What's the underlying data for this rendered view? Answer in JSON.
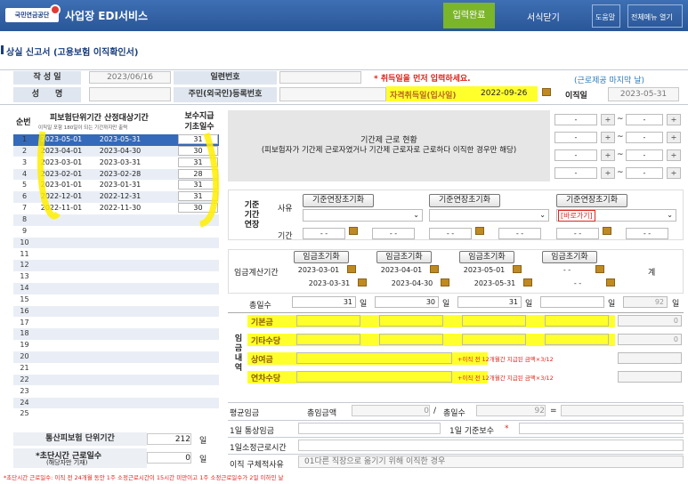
{
  "topbar": {
    "logo": "국민연금공단",
    "title": "사업장 EDI서비스",
    "submit": "입력완료",
    "close": "서식닫기",
    "help": "도움말",
    "menu": "전체메뉴 열기"
  },
  "page": {
    "title": "상실 신고서 (고용보험 이직확인서)"
  },
  "header": {
    "created_label": "작 성 일",
    "created_value": "2023/06/16",
    "serial_label": "일련번호",
    "warning": "* 취득일을 먼저 입력하세요.",
    "last_workday": "(근로제공 마지막 날)",
    "name_label": "성　　명",
    "rrn_label": "주민(외국인)등록번호",
    "acq_label": "자격취득일(입사일)",
    "acq_value": "2022-09-26",
    "leave_label": "이직일",
    "leave_value": "2023-05-31"
  },
  "left_table": {
    "col_no": "순번",
    "col_period": "피보험단위기간 산정대상기간",
    "col_period_sub": "이직일 포함 180일이 되는 기간까지만 출력",
    "col_days": "보수지급 기초일수",
    "rows": [
      {
        "no": "1",
        "from": "2023-05-01",
        "to": "2023-05-31",
        "days": "31"
      },
      {
        "no": "2",
        "from": "2023-04-01",
        "to": "2023-04-30",
        "days": "30"
      },
      {
        "no": "3",
        "from": "2023-03-01",
        "to": "2023-03-31",
        "days": "31"
      },
      {
        "no": "4",
        "from": "2023-02-01",
        "to": "2023-02-28",
        "days": "28"
      },
      {
        "no": "5",
        "from": "2023-01-01",
        "to": "2023-01-31",
        "days": "31"
      },
      {
        "no": "6",
        "from": "2022-12-01",
        "to": "2022-12-31",
        "days": "31"
      },
      {
        "no": "7",
        "from": "2022-11-01",
        "to": "2022-11-30",
        "days": "30"
      },
      {
        "no": "8",
        "from": "",
        "to": "",
        "days": ""
      },
      {
        "no": "9",
        "from": "",
        "to": "",
        "days": ""
      },
      {
        "no": "10",
        "from": "",
        "to": "",
        "days": ""
      },
      {
        "no": "11",
        "from": "",
        "to": "",
        "days": ""
      },
      {
        "no": "12",
        "from": "",
        "to": "",
        "days": ""
      },
      {
        "no": "13",
        "from": "",
        "to": "",
        "days": ""
      },
      {
        "no": "14",
        "from": "",
        "to": "",
        "days": ""
      },
      {
        "no": "15",
        "from": "",
        "to": "",
        "days": ""
      },
      {
        "no": "16",
        "from": "",
        "to": "",
        "days": ""
      },
      {
        "no": "17",
        "from": "",
        "to": "",
        "days": ""
      },
      {
        "no": "18",
        "from": "",
        "to": "",
        "days": ""
      },
      {
        "no": "19",
        "from": "",
        "to": "",
        "days": ""
      },
      {
        "no": "20",
        "from": "",
        "to": "",
        "days": ""
      },
      {
        "no": "21",
        "from": "",
        "to": "",
        "days": ""
      },
      {
        "no": "22",
        "from": "",
        "to": "",
        "days": ""
      },
      {
        "no": "23",
        "from": "",
        "to": "",
        "days": ""
      },
      {
        "no": "24",
        "from": "",
        "to": "",
        "days": ""
      },
      {
        "no": "25",
        "from": "",
        "to": "",
        "days": ""
      }
    ],
    "total_period_label": "통산피보험 단위기간",
    "total_period_value": "212",
    "total_period_unit": "일",
    "short_label": "*초단시간 근로일수",
    "short_sub": "(해당자만 기재)",
    "short_value": "0",
    "short_unit": "일"
  },
  "contract": {
    "line1": "기간제 근로 현황",
    "line2": "(피보험자가 기간제 근로자였거나 기간제 근로자로 근로하다 이직한 경우만 해당)",
    "dash": "-"
  },
  "extension": {
    "label": "기준\n기간\n연장",
    "reason": "사유",
    "period": "기간",
    "btn": "기준연장초기화",
    "link": "[바로가기]"
  },
  "wage": {
    "period_label": "임금계산기간",
    "btn": "임금초기화",
    "total_label": "계",
    "periods": [
      {
        "from": "2023-03-01",
        "to": "2023-03-31"
      },
      {
        "from": "2023-04-01",
        "to": "2023-04-30"
      },
      {
        "from": "2023-05-01",
        "to": "2023-05-31"
      },
      {
        "from": "- -",
        "to": "- -"
      }
    ],
    "days_label": "총일수",
    "days": [
      "31",
      "30",
      "31",
      ""
    ],
    "day_unit": "일",
    "days_total": "92",
    "detail_label": "임금내역",
    "items": [
      {
        "label": "기본금",
        "note": "",
        "total": "0"
      },
      {
        "label": "기타수당",
        "note": "",
        "total": "0"
      },
      {
        "label": "상여금",
        "note": "+이직 전 12개월간 지급된 금액×3/12",
        "total": ""
      },
      {
        "label": "연차수당",
        "note": "+이직 전 12개월간 지급된 금액×3/12",
        "total": ""
      }
    ]
  },
  "avg": {
    "label": "평균임금",
    "amount_label": "총임금액",
    "amount": "0",
    "slash": "/",
    "days_label": "총일수",
    "days": "92",
    "eq": "="
  },
  "daily": {
    "label": "1일 통상임금",
    "base_label": "1일 기준보수",
    "required": "*"
  },
  "hours": {
    "label": "1일소정근로시간"
  },
  "reason": {
    "label": "이직 구체적사유",
    "value": "01다른 직장으로 옮기기 위해 이직한 경우"
  },
  "footnote": "*초단시간 근로일수: 이직 전 24개월 동안 1주 소정근로시간이 15시간 미만이고 1주 소정근로일수가 2일 이하인 날"
}
